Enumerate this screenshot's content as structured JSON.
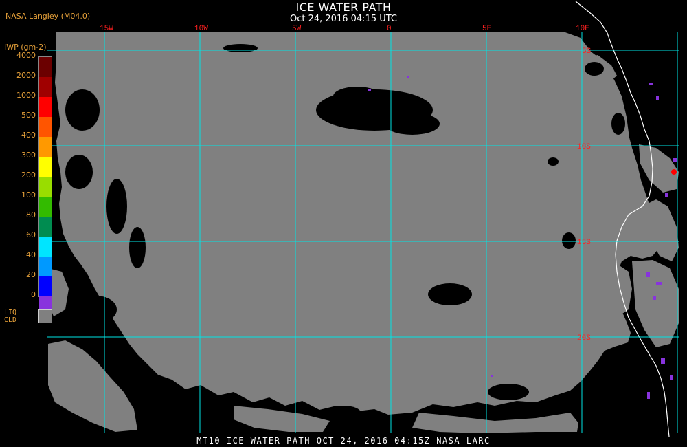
{
  "header": {
    "title": "ICE WATER PATH",
    "subtitle": "Oct 24, 2016 04:15 UTC",
    "source": "NASA Langley (M04.0)"
  },
  "map": {
    "lon_labels": [
      "15W",
      "10W",
      "5W",
      "0",
      "5E",
      "10E"
    ],
    "lat_labels": [
      "5S",
      "10S",
      "15S",
      "20S"
    ],
    "grid_color": "#00e5e5",
    "label_color": "#ff2020",
    "coast_color": "#ffffff",
    "land_color": "#000000"
  },
  "legend": {
    "title": "IWP (gm-2)",
    "ticks": [
      "4000",
      "2000",
      "1000",
      "500",
      "400",
      "300",
      "200",
      "100",
      "80",
      "60",
      "40",
      "20",
      "0"
    ],
    "colors": [
      "#6b0000",
      "#a00000",
      "#ff0000",
      "#ff5500",
      "#ff9900",
      "#ffff00",
      "#99dd00",
      "#33bb00",
      "#008c50",
      "#00e5ff",
      "#0099ff",
      "#0000ff",
      "#8833dd"
    ],
    "liq_label_line1": "LIQ",
    "liq_label_line2": "CLD",
    "liq_color": "#808080"
  },
  "footer": {
    "text": "MT10  ICE WATER PATH  OCT 24, 2016 04:15Z  NASA LARC"
  }
}
